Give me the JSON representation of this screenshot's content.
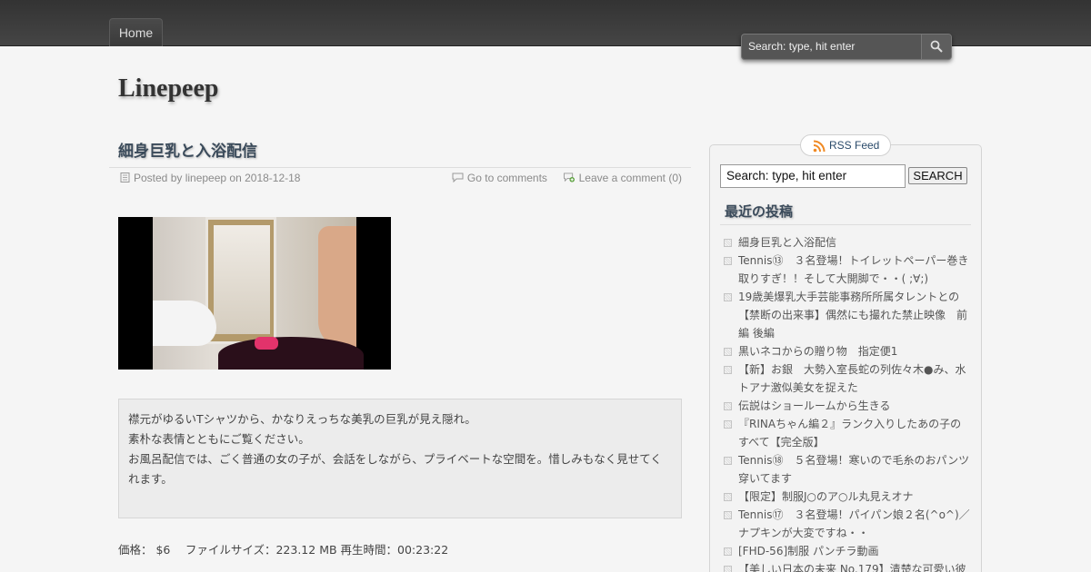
{
  "nav": {
    "home_label": "Home"
  },
  "header_search": {
    "placeholder": "Search: type, hit enter"
  },
  "site": {
    "title": "Linepeep"
  },
  "post": {
    "title": "細身巨乳と入浴配信",
    "posted_by": "Posted by linepeep on 2018-12-18",
    "go_to_comments": "Go to comments",
    "leave_comment": "Leave a comment (0)",
    "description": [
      "襟元がゆるいTシャツから、かなりえっちな美乳の巨乳が見え隠れ。",
      "素朴な表情とともにご覧ください。",
      "お風呂配信では、ごく普通の女の子が、会話をしながら、プライベートな空間を。惜しみもなく見せてくれます。"
    ],
    "price_line": "価格： $6　 ファイルサイズ：223.12 MB 再生時間：00:23:22"
  },
  "sidebar": {
    "rss_label": "RSS Feed",
    "search_value": "Search: type, hit enter",
    "search_button": "SEARCH",
    "recent_title": "最近の投稿",
    "recent_posts": [
      "細身巨乳と入浴配信",
      "Tennis⑬　３名登場！トイレットペーパー巻き取りすぎ！！そして大開脚で・・( ;∀;)",
      "19歳美爆乳大手芸能事務所所属タレントとの【禁断の出来事】偶然にも撮れた禁止映像　前編 後編",
      "黒いネコからの贈り物　指定便1",
      "【新】お銀　大勢入室長蛇の列佐々木●み、水トアナ激似美女を捉えた",
      "伝説はショールームから生きる",
      "『RINAちゃん編２』ランク入りしたあの子のすべて【完全版】",
      "Tennis⑱　５名登場！寒いので毛糸のおパンツ穿いてます",
      "【限定】制服J○のア○ル丸見えオナ",
      "Tennis⑰　３名登場！パイパン娘２名(^o^)／ナプキンが大変ですね・・",
      "[FHD-56]制服 パンチラ動画",
      "【美しい日本の未来 No.179】清楚な可愛い彼"
    ]
  }
}
